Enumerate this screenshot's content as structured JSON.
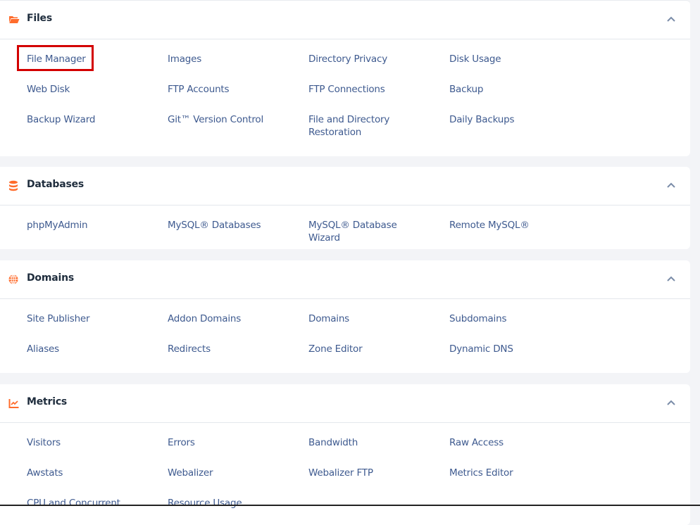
{
  "sections": [
    {
      "title": "Files",
      "icon": "folder-open-icon",
      "expanded": true,
      "items": [
        "File Manager",
        "Images",
        "Directory Privacy",
        "Disk Usage",
        "Web Disk",
        "FTP Accounts",
        "FTP Connections",
        "Backup",
        "Backup Wizard",
        "Git™ Version Control",
        "File and Directory Restoration",
        "Daily Backups"
      ]
    },
    {
      "title": "Databases",
      "icon": "database-icon",
      "expanded": true,
      "items": [
        "phpMyAdmin",
        "MySQL® Databases",
        "MySQL® Database Wizard",
        "Remote MySQL®"
      ]
    },
    {
      "title": "Domains",
      "icon": "globe-icon",
      "expanded": true,
      "items": [
        "Site Publisher",
        "Addon Domains",
        "Domains",
        "Subdomains",
        "Aliases",
        "Redirects",
        "Zone Editor",
        "Dynamic DNS"
      ]
    },
    {
      "title": "Metrics",
      "icon": "chart-line-icon",
      "expanded": true,
      "items": [
        "Visitors",
        "Errors",
        "Bandwidth",
        "Raw Access",
        "Awstats",
        "Webalizer",
        "Webalizer FTP",
        "Metrics Editor",
        "CPU and Concurrent",
        "Resource Usage"
      ]
    }
  ],
  "highlighted_item": "File Manager",
  "colors": {
    "accent_icon": "#ff6c2c",
    "link": "#3e5a8f",
    "highlight_border": "#d30000"
  }
}
